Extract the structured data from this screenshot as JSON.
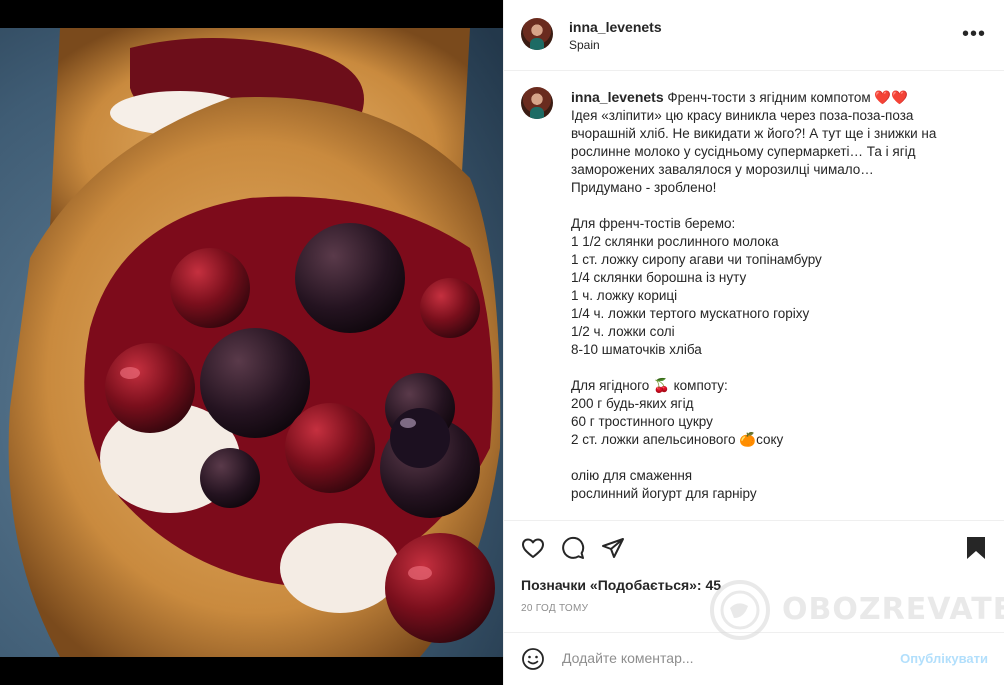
{
  "post": {
    "username": "inna_levenets",
    "location": "Spain",
    "more_icon": "more-horizontal-icon"
  },
  "caption": {
    "username": "inna_levenets",
    "title": "Френч-тости з ягідним компотом ❤️❤️",
    "lines": [
      "Ідея «зліпити» цю красу виникла через поза-поза-поза",
      "вчорашній хліб. Не викидати ж його?! А тут ще і знижки на",
      "рослинне молоко у сусідньому супермаркеті… Та і ягід",
      "заморожених завалялося у морозилці чимало…",
      "Придумано - зроблено!",
      "",
      "Для френч-тостів беремо:",
      "1 1/2 склянки рослинного молока",
      "1 ст. ложку сиропу агави чи топінамбуру",
      "1/4 склянки борошна із нуту",
      "1 ч. ложку кориці",
      "1/4 ч. ложки тертого мускатного горіху",
      "1/2 ч. ложки солі",
      "8-10 шматочків хліба",
      "",
      "Для ягідного 🍒 компоту:",
      "200 г будь-яких ягід",
      "60 г тростинного цукру",
      "2 ст. ложки апельсинового 🍊соку",
      "",
      "олію для смаження",
      "рослинний йогурт для гарніру"
    ]
  },
  "actions": {
    "like_icon": "heart-icon",
    "comment_icon": "comment-icon",
    "share_icon": "send-icon",
    "save_icon": "bookmark-icon",
    "likes_text": "Позначки «Подобається»: 45",
    "time_text": "20 ГОД ТОМУ"
  },
  "comment": {
    "emoji_icon": "smile-icon",
    "placeholder": "Додайте коментар...",
    "publish_label": "Опублікувати"
  },
  "watermark": {
    "text": "OBOZREVATEL"
  },
  "colors": {
    "publish": "#b2dffc",
    "muted": "#8e8e8e",
    "text": "#262626"
  }
}
